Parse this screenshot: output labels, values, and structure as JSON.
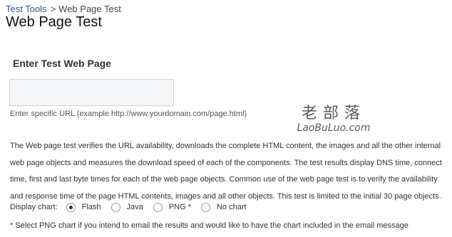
{
  "breadcrumb": {
    "root": "Test Tools",
    "separator": ">",
    "current": "Web Page Test"
  },
  "page": {
    "title": "Web Page Test"
  },
  "form": {
    "section_title": "Enter Test Web Page",
    "url": {
      "value": "",
      "placeholder": ""
    },
    "url_hint": "Enter specific URL (example http://www.yourdomain.com/page.html)"
  },
  "watermark": {
    "chinese": "老部落",
    "latin": "LaoBuLuo.com"
  },
  "description": "The Web page test verifies the URL availability, downloads the complete HTML content, the images and all the other internal web page objects and measures the download speed of each of the components. The test results display DNS time, connect time, first and last byte times for each of the web page objects. Common use of the web page test is to verify the availability and response time of the page HTML contents, images and all other objects. This test is limited to the initial 30 page objects.",
  "chart_options": {
    "label": "Display chart:",
    "selected": "Flash",
    "options": [
      "Flash",
      "Java",
      "PNG *",
      "No chart"
    ]
  },
  "note": "* Select PNG chart if you intend to email the results and would like to have the chart included in the email message"
}
